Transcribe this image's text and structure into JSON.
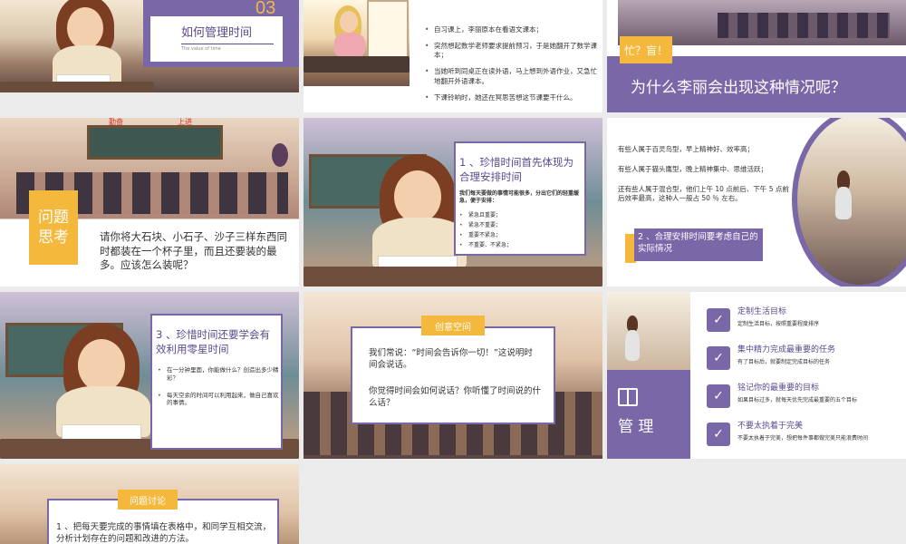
{
  "slides": {
    "s1": {
      "number": "03",
      "title": "如何管理时间",
      "subtitle": "The value of time"
    },
    "s2": {
      "bullets": [
        "自习课上，李丽原本在看语文课本；",
        "突然想起数学老师要求提前预习，于是她翻开了数学课本；",
        "当她听到同桌正在读外语，马上想到外语作业，又急忙地翻开外语课本。",
        "下课铃响时，她还在冥思苦想这节课要干什么。"
      ]
    },
    "s3": {
      "tag": "忙？盲！",
      "question": "为什么李丽会出现这种情况呢？"
    },
    "s4": {
      "board_left": "勤奋",
      "board_right": "上进",
      "label": "问题思考",
      "text": "请你将大石块、小石子、沙子三样东西同时都装在一个杯子里，而且还要装的最多。应该怎么装呢？"
    },
    "s5": {
      "title": "1 、珍惜时间首先体现为合理安排时间",
      "intro": "我们每天要做的事情可能很多，分出它们的轻重缓急，便于安排：",
      "items": [
        "紧急且重要；",
        "紧急不重要；",
        "重要不紧急；",
        "不重要、不紧急；"
      ]
    },
    "s6": {
      "lines": [
        "有些人属于百灵鸟型，早上精神好、效率高；",
        "有些人属于猫头鹰型，晚上精神集中、思维活跃；",
        "还有些人属于混合型，他们上午 10 点前后、下午 5 点前后效率最高，这种人一般占 50 ％ 左右。"
      ],
      "banner": "2 、合理安排时间要考虑自己的实际情况"
    },
    "s7": {
      "title": "3 、珍惜时间还要学会有效利用零星时间",
      "bullets": [
        "在一分钟里面，你能做什么？创造出多少精彩？",
        "每天空余的时间可以利用起来，做自己喜欢的事情。"
      ]
    },
    "s8": {
      "tag": "创意空间",
      "p1": "我们常说：“时间会告诉你一切！”这说明时间会说话。",
      "p2": "你觉得时间会如何说话？你听懂了时间说的什么话？"
    },
    "s9": {
      "side_title": "管 理",
      "items": [
        {
          "title": "定制生活目标",
          "desc": "定制生活目标，按照重要程度排序"
        },
        {
          "title": "集中精力完成最重要的任务",
          "desc": "有了目标后，就要制定完成目标的任务"
        },
        {
          "title": "铭记你的最重要的目标",
          "desc": "如果目标过多，就每天优先完成最重要的五个目标"
        },
        {
          "title": "不要太执着于完美",
          "desc": "不要太执着于完美，想把每件事都做完美只能浪费时间"
        }
      ]
    },
    "s10": {
      "tag": "问题讨论",
      "text": "1 、把每天要完成的事情填在表格中，和同学互相交流，分析计划存在的问题和改进的方法。"
    }
  },
  "colors": {
    "accent": "#7a67a8",
    "gold": "#f3b83c"
  },
  "icons": {
    "book": "book-icon",
    "badge": "shield-badge-icon"
  }
}
